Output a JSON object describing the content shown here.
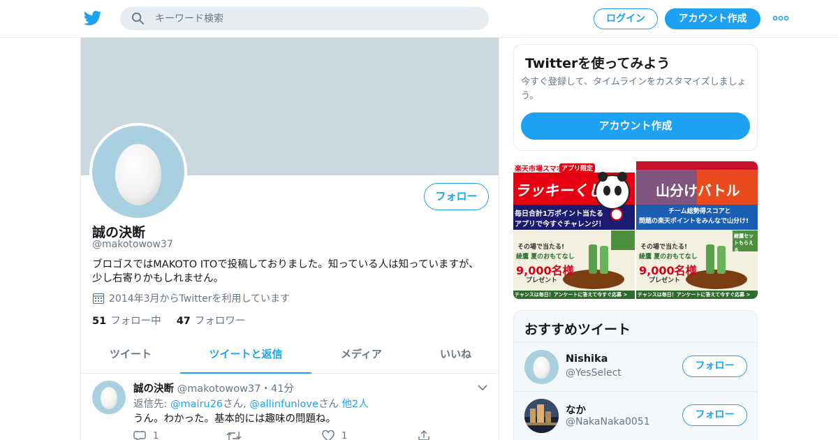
{
  "header": {
    "logo_icon": "twitter-bird-icon",
    "search_placeholder": "キーワード検索",
    "login_label": "ログイン",
    "signup_label": "アカウント作成",
    "more_icon": "more-dots-icon",
    "brand_color": "#1da1f2"
  },
  "profile": {
    "name": "誠の決断",
    "handle": "@makotowow37",
    "bio": "ブロゴスではMAKOTO ITOで投稿しておりました。知っている人は知っていますが、少し右寄りかもしれません。",
    "joined": "2014年3月からTwitterを利用しています",
    "following_count": "51",
    "following_label": "フォロー中",
    "followers_count": "47",
    "followers_label": "フォロワー",
    "follow_button": "フォロー"
  },
  "tabs": [
    {
      "label": "ツイート",
      "active": false
    },
    {
      "label": "ツイートと返信",
      "active": true
    },
    {
      "label": "メディア",
      "active": false
    },
    {
      "label": "いいね",
      "active": false
    }
  ],
  "tweet": {
    "name": "誠の決断",
    "handle": "@makotowow37",
    "sep": "・",
    "time": "41分",
    "reply_prefix": "返信先: ",
    "reply_user1": "@mairu26",
    "reply_san1": "さん, ",
    "reply_user2": "@allinfunlove",
    "reply_san2": "さん ",
    "reply_others": "他2人",
    "text": "うん。わかった。基本的には趣味の問題ね。",
    "reply_count": "1",
    "like_count": "1"
  },
  "signup_card": {
    "title": "Twitterを使ってみよう",
    "description": "今すぐ登録して、タイムラインをカスタマイズしましょう。",
    "cta": "アカウント作成"
  },
  "ads": {
    "ad1_tag": "楽天市場スマホ",
    "ad1_badge": "アプリ限定",
    "ad1_title": "ラッキーくじ",
    "ad1_sub1": "毎日合計1万ポイント当たる",
    "ad1_sub2": "アプリで今すぐチャレンジ！",
    "ad2_title": "山分けバトル",
    "ad2_sub1": "チーム総勢得スコアと",
    "ad2_sub2": "問題の楽天ポイントをみんなで山分け!",
    "ad3_head": "その場で当たる!",
    "ad3_brand": "綾鷹 夏のおもてなし",
    "ad3_prize": "9,000名様",
    "ad3_present": "プレゼント",
    "ad3_badge": "綾鷹セットもらえる",
    "ad3_footer": "チャンスは毎日！アンケートに答えて今すぐ応募 >"
  },
  "recommended": {
    "title": "おすすめツイート",
    "items": [
      {
        "name": "Nishika",
        "handle": "@YesSelect",
        "button": "フォロー"
      },
      {
        "name": "なか",
        "handle": "@NakaNaka0051",
        "button": "フォロー"
      }
    ]
  }
}
